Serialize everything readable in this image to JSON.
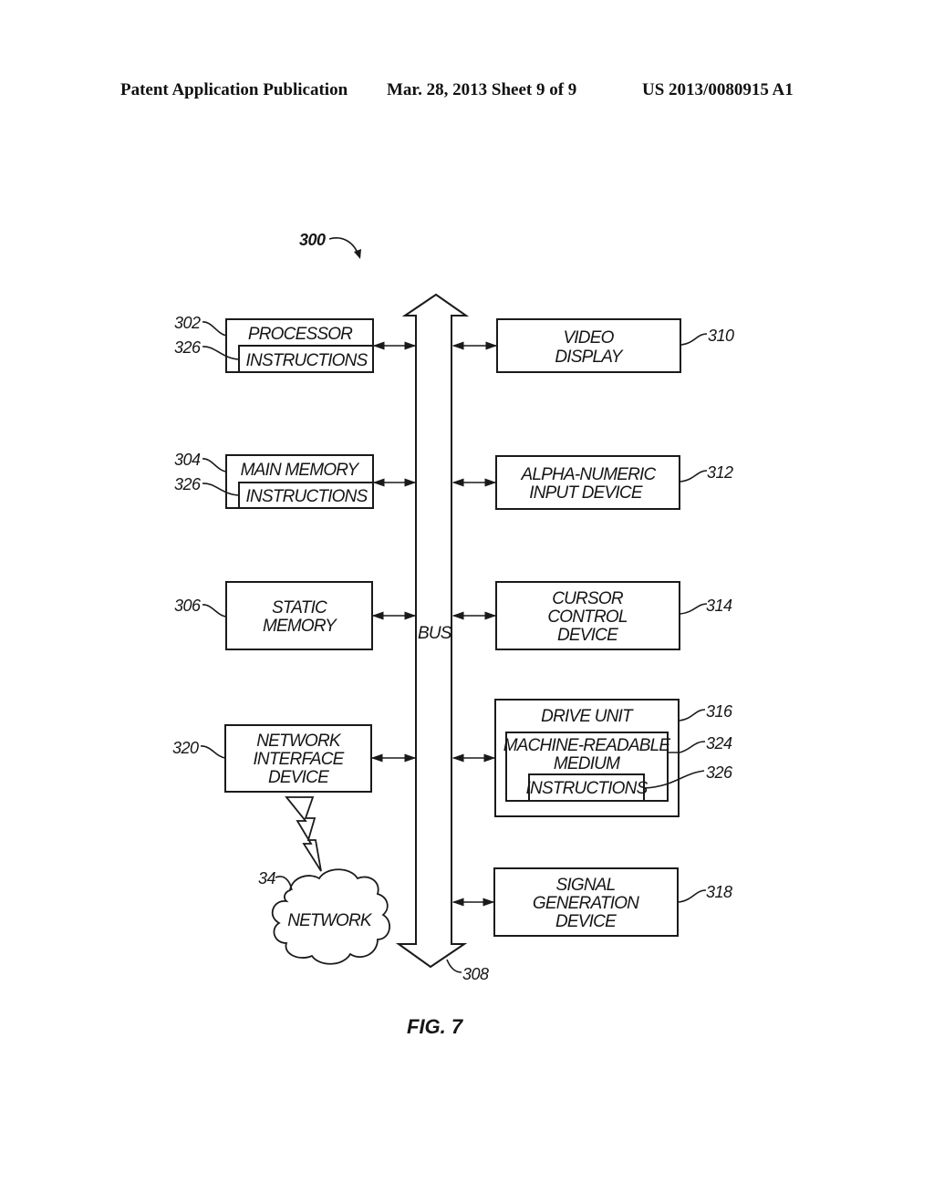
{
  "header": {
    "publication": "Patent Application Publication",
    "date_sheet": "Mar. 28, 2013  Sheet 9 of 9",
    "patent_number": "US 2013/0080915 A1"
  },
  "figure": {
    "system_ref": "300",
    "caption": "FIG. 7",
    "bus": {
      "label": "BUS",
      "ref": "308"
    },
    "left_components": [
      {
        "ref": "302",
        "lines": [
          "PROCESSOR"
        ],
        "sub": {
          "ref": "326",
          "label": "INSTRUCTIONS"
        }
      },
      {
        "ref": "304",
        "lines": [
          "MAIN MEMORY"
        ],
        "sub": {
          "ref": "326",
          "label": "INSTRUCTIONS"
        }
      },
      {
        "ref": "306",
        "lines": [
          "STATIC",
          "MEMORY"
        ]
      },
      {
        "ref": "320",
        "lines": [
          "NETWORK",
          "INTERFACE",
          "DEVICE"
        ]
      }
    ],
    "right_components": [
      {
        "ref": "310",
        "lines": [
          "VIDEO",
          "DISPLAY"
        ]
      },
      {
        "ref": "312",
        "lines": [
          "ALPHA-NUMERIC",
          "INPUT DEVICE"
        ]
      },
      {
        "ref": "314",
        "lines": [
          "CURSOR",
          "CONTROL",
          "DEVICE"
        ]
      },
      {
        "ref": "316",
        "lines": [
          "DRIVE UNIT"
        ],
        "medium": {
          "ref": "324",
          "lines": [
            "MACHINE-READABLE",
            "MEDIUM"
          ]
        },
        "instructions": {
          "ref": "326",
          "label": "INSTRUCTIONS"
        }
      },
      {
        "ref": "318",
        "lines": [
          "SIGNAL",
          "GENERATION",
          "DEVICE"
        ]
      }
    ],
    "network": {
      "ref": "34",
      "label": "NETWORK"
    }
  }
}
